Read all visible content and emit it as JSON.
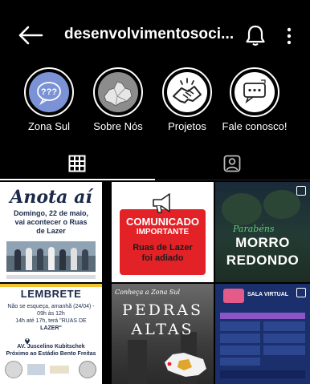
{
  "header": {
    "title": "desenvolvimentosoci..."
  },
  "highlights": [
    {
      "label": "Zona Sul",
      "icon": "question-bubbles-icon",
      "color": "#7b93d6"
    },
    {
      "label": "Sobre Nós",
      "icon": "map-icon",
      "color": "#8c8c8c"
    },
    {
      "label": "Projetos",
      "icon": "handshake-icon",
      "color": "#ffffff"
    },
    {
      "label": "Fale conosco!",
      "icon": "chat-bubble-icon",
      "color": "#ffffff"
    }
  ],
  "tabs": [
    {
      "name": "posts",
      "icon": "grid-icon",
      "active": true
    },
    {
      "name": "tagged",
      "icon": "tagged-person-icon",
      "active": false
    }
  ],
  "posts": {
    "p1": {
      "title": "Anota aí",
      "line1": "Domingo, 22 de maio,",
      "line2": "vai acontecer o Ruas",
      "line3": "de Lazer"
    },
    "p2": {
      "heading1": "COMUNICADO",
      "heading2": "IMPORTANTE",
      "body1": "Ruas de Lazer",
      "body2": "foi adiado"
    },
    "p3": {
      "script": "Parabéns",
      "line1": "MORRO",
      "line2": "REDONDO"
    },
    "p4": {
      "title": "LEMBRETE",
      "t1": "Não se esqueça, amanhã (24/04) -",
      "t2": "09h às 12h",
      "t3": "14h até 17h, terá \"RUAS DE",
      "t4": "LAZER\"",
      "a1": "AV. Juscelino Kubitschek",
      "a2": "Próximo ao Estádio Bento Freitas"
    },
    "p5": {
      "top": "Conheça a Zona Sul",
      "line1": "PEDRAS",
      "line2": "ALTAS"
    },
    "p6": {
      "title": "SALA VIRTUAL"
    }
  },
  "colors": {
    "background": "#000000",
    "text": "#ffffff",
    "comunicado_red": "#e32227",
    "navy": "#1b2a4a",
    "lembrete_yellow": "#f2c230",
    "sala_virtual_bg": "#1a2f6b",
    "sala_virtual_accent": "#8a56c6"
  }
}
